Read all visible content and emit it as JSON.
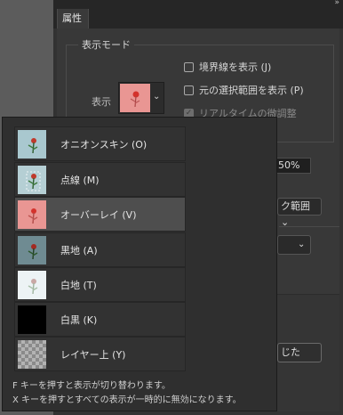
{
  "panel": {
    "collapse_icon": "»",
    "tab_label": "属性",
    "group_title": "表示モード",
    "view_label": "表示",
    "view_thumb_icon": "overlay-thumbnail-icon",
    "checkboxes": [
      {
        "label": "境界線を表示 (J)",
        "checked": false,
        "enabled": true
      },
      {
        "label": "元の選択範囲を表示 (P)",
        "checked": false,
        "enabled": true
      },
      {
        "label": "リアルタイムの微調整",
        "checked": true,
        "enabled": false
      }
    ],
    "opacity_value": "50%",
    "range_select_label": "ク範囲",
    "close_button_label": "じた"
  },
  "popup": {
    "options": [
      {
        "label": "オニオンスキン (O)",
        "icon": "onion-skin-icon",
        "selected": false
      },
      {
        "label": "点線 (M)",
        "icon": "marching-ants-icon",
        "selected": false
      },
      {
        "label": "オーバーレイ (V)",
        "icon": "overlay-icon",
        "selected": true
      },
      {
        "label": "黒地 (A)",
        "icon": "on-black-icon",
        "selected": false
      },
      {
        "label": "白地 (T)",
        "icon": "on-white-icon",
        "selected": false
      },
      {
        "label": "白黒 (K)",
        "icon": "black-white-icon",
        "selected": false
      },
      {
        "label": "レイヤー上 (Y)",
        "icon": "on-layers-icon",
        "selected": false
      }
    ],
    "hint_f": "F キーを押すと表示が切り替わります。",
    "hint_x": "X キーを押すとすべての表示が一時的に無効になります。"
  },
  "colors": {
    "panel_bg": "#383838",
    "popup_bg": "#2f2f2f",
    "selected_row": "#4e4e4e",
    "overlay_pink": "#e99693"
  }
}
